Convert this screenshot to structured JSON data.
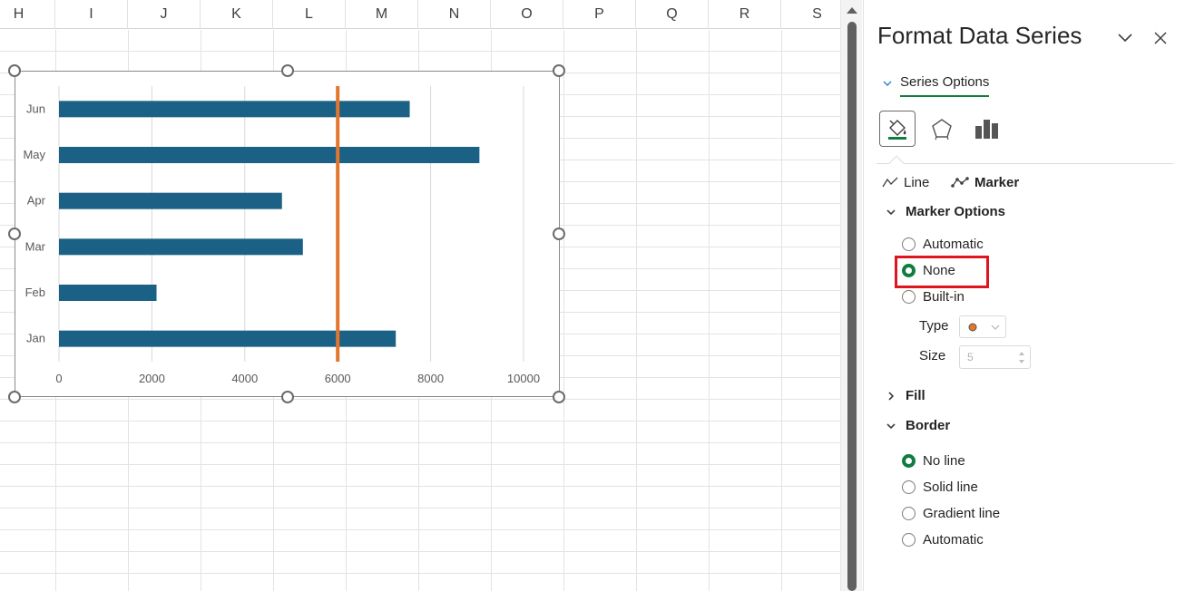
{
  "sheet": {
    "columns": [
      "H",
      "I",
      "J",
      "K",
      "L",
      "M",
      "N",
      "O",
      "P",
      "Q",
      "R",
      "S"
    ]
  },
  "chart_data": {
    "type": "bar",
    "orientation": "horizontal",
    "categories": [
      "Jan",
      "Feb",
      "Mar",
      "Apr",
      "May",
      "Jun"
    ],
    "series": [
      {
        "values": [
          7250,
          2100,
          5250,
          4800,
          9050,
          7550
        ],
        "color": "#1b6185"
      }
    ],
    "reference_line": {
      "x": 6000,
      "color": "#e2762d"
    },
    "xlim": [
      0,
      10000
    ],
    "x_ticks": [
      "0",
      "2000",
      "4000",
      "6000",
      "8000",
      "10000"
    ],
    "x_tick_values": [
      0,
      2000,
      4000,
      6000,
      8000,
      10000
    ],
    "gridlines": true,
    "legend": false,
    "title": ""
  },
  "pane": {
    "title": "Format Data Series",
    "tab_label": "Series Options",
    "subtab_line": "Line",
    "subtab_marker": "Marker",
    "marker_options": {
      "header": "Marker Options",
      "options": [
        "Automatic",
        "None",
        "Built-in"
      ],
      "selected": "None",
      "type_label": "Type",
      "size_label": "Size",
      "size_value": "5"
    },
    "fill_header": "Fill",
    "border": {
      "header": "Border",
      "options": [
        "No line",
        "Solid line",
        "Gradient line",
        "Automatic"
      ],
      "selected": "No line"
    }
  },
  "colors": {
    "accent": "#107c41",
    "bar": "#1b6185",
    "reference": "#e2762d",
    "highlight": "#e0141e"
  }
}
